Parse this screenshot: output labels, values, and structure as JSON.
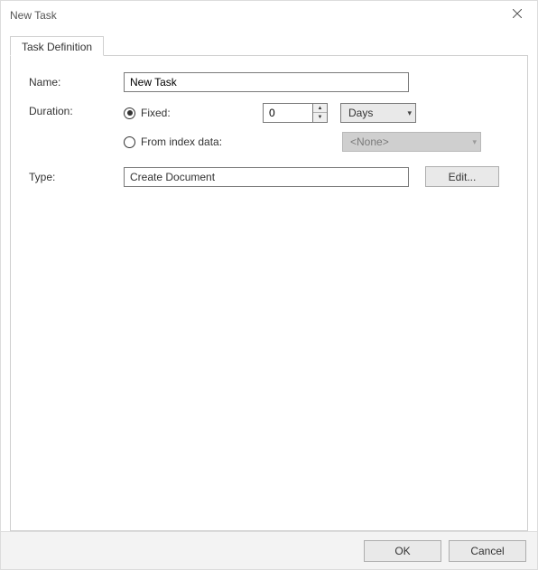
{
  "window": {
    "title": "New Task"
  },
  "tabs": {
    "definition_label": "Task Definition"
  },
  "form": {
    "name_label": "Name:",
    "name_value": "New Task",
    "duration_label": "Duration:",
    "fixed_label": "Fixed:",
    "fixed_value": "0",
    "unit_value": "Days",
    "from_index_label": "From index data:",
    "index_value": "<None>",
    "type_label": "Type:",
    "type_value": "Create Document",
    "edit_label": "Edit..."
  },
  "footer": {
    "ok_label": "OK",
    "cancel_label": "Cancel"
  }
}
